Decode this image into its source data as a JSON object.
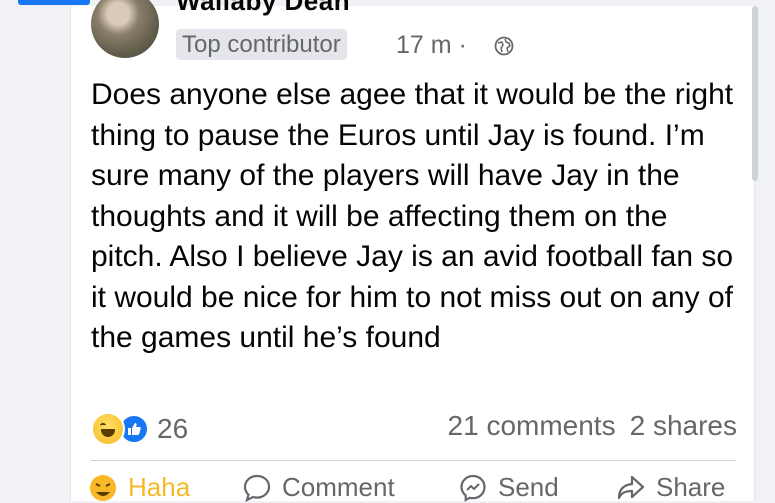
{
  "post": {
    "author": "Wallaby Dean",
    "badge": "Top contributor",
    "time": "17 m · ",
    "privacy_icon": "globe-icon",
    "text": "Does anyone else agee that it would be the right thing to pause the Euros until Jay is found. I’m sure many of the players will have Jay in the thoughts and it will be affecting them on the pitch. Also I believe Jay is an avid football fan so it would be nice for him to not miss out on any of the games until he’s found"
  },
  "stats": {
    "reaction_icons": [
      "haha-reaction-icon",
      "like-reaction-icon"
    ],
    "reaction_count": "26",
    "comments": "21 comments",
    "shares": "2 shares"
  },
  "actions": {
    "haha": "Haha",
    "comment": "Comment",
    "send": "Send",
    "share": "Share"
  },
  "colors": {
    "accent": "#1877f2",
    "haha": "#f7b928",
    "text": "#050505",
    "muted": "#65676b"
  }
}
